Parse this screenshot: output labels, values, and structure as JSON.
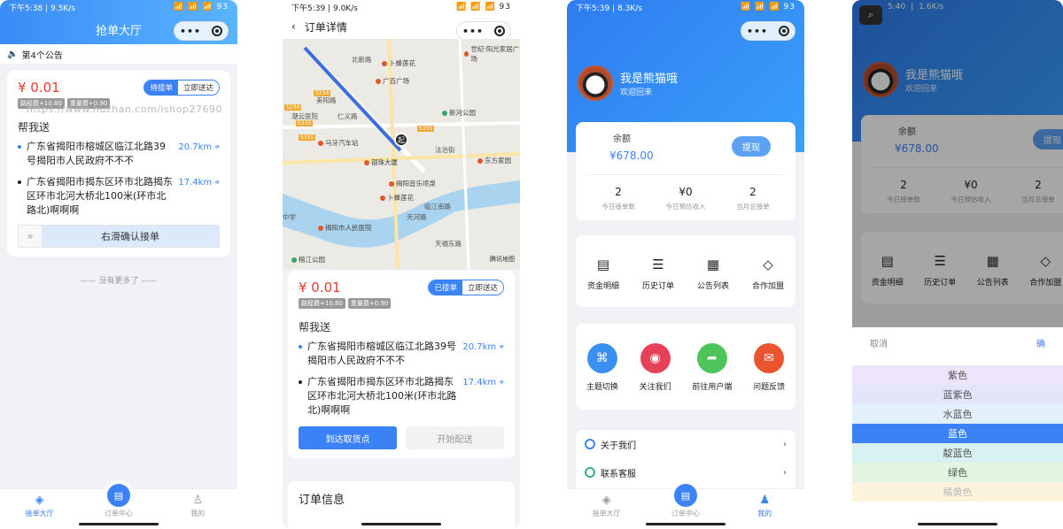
{
  "watermark": "https://www.huzhan.com/ishop27690",
  "screen1": {
    "status": {
      "time": "下午5:38",
      "speed": "9.5K/s",
      "icons": "📶 📶 📶 93"
    },
    "title": "抢单大厅",
    "notice": "第4个公告",
    "order": {
      "price": "¥ 0.01",
      "tag_active": "待接单",
      "tag_other": "立即送达",
      "fee1": "路程费+10.80",
      "fee2": "重量费+0.90",
      "help": "帮我送",
      "from": "广东省揭阳市榕城区临江北路39号揭阳市人民政府不不不",
      "from_dist": "20.7km",
      "to": "广东省揭阳市揭东区环市北路揭东区环市北河大桥北100米(环市北路北)啊啊啊",
      "to_dist": "17.4km",
      "slide_label": "右滑确认接单"
    },
    "nomore": "—— 没有更多了 ——",
    "tabs": [
      "接单大厅",
      "订单中心",
      "我的"
    ]
  },
  "screen2": {
    "status": {
      "time": "下午5:39",
      "speed": "9.0K/s",
      "icons": "📶 📶 📶 93"
    },
    "title": "订单详情",
    "map_labels": {
      "poi": [
        "卜蜂莲花",
        "广百广场",
        "新河公园",
        "马牙汽车站",
        "银珠大厦",
        "揭阳音乐喷泉",
        "卜蜂莲花",
        "揭阳市人民医院",
        "东方家园",
        "世纪·阳光家居广场",
        "榕江公园"
      ],
      "areas": [
        "北新路",
        "美阳路",
        "仁义路",
        "潮云医院",
        "法治街",
        "临江南路",
        "天福东路",
        "中学",
        "天河路"
      ],
      "shields": [
        "S234",
        "S234",
        "S335",
        "S335",
        "S335"
      ],
      "start_marker": "起",
      "logo": "腾讯地图"
    },
    "order": {
      "price": "¥ 0.01",
      "tag_active": "已接单",
      "tag_other": "立即送达",
      "fee1": "路程费+10.80",
      "fee2": "重量费+0.90",
      "help": "帮我送",
      "from": "广东省揭阳市榕城区临江北路39号揭阳市人民政府不不不",
      "from_dist": "20.7km",
      "to": "广东省揭阳市揭东区环市北路揭东区环市北河大桥北100米(环市北路北)啊啊啊",
      "to_dist": "17.4km",
      "btn_primary": "到达取货点",
      "btn_secondary": "开始配送"
    },
    "info_title": "订单信息"
  },
  "screen3": {
    "status": {
      "time": "下午5:39",
      "speed": "8.3K/s",
      "icons": "📶 📶 📶 93"
    },
    "name": "我是熊猫哦",
    "welcome": "欢迎回来",
    "balance_label": "余额",
    "balance": "¥678.00",
    "withdraw": "提现",
    "stats": [
      {
        "value": "2",
        "label": "今日接单数"
      },
      {
        "value": "¥0",
        "label": "今日预估收入"
      },
      {
        "value": "2",
        "label": "当月总接单"
      }
    ],
    "menu": [
      "资金明细",
      "历史订单",
      "公告列表",
      "合作加盟"
    ],
    "actions": [
      "主题切换",
      "关注我们",
      "前往用户端",
      "问题反馈"
    ],
    "action_colors": [
      "#3b8ff0",
      "#e6415a",
      "#4cc45a",
      "#ea5530"
    ],
    "list": [
      "关于我们",
      "联系客服"
    ],
    "tabs": [
      "接单大厅",
      "订单中心",
      "我的"
    ]
  },
  "screen4": {
    "status": {
      "time": "5:40",
      "speed": "1.6K/s"
    },
    "name": "我是熊猫哦",
    "welcome": "欢迎回来",
    "balance_label": "余额",
    "balance": "¥678.00",
    "withdraw": "提现",
    "stats": [
      {
        "value": "2",
        "label": "今日接单数"
      },
      {
        "value": "¥0",
        "label": "今日预估收入"
      },
      {
        "value": "2",
        "label": "当月总接单"
      }
    ],
    "menu": [
      "资金明细",
      "历史订单",
      "公告列表",
      "合作加盟"
    ],
    "cancel": "取消",
    "confirm": "确",
    "options": [
      "紫色",
      "蓝紫色",
      "水蓝色",
      "蓝色",
      "靛蓝色",
      "绿色",
      "橘黄色"
    ],
    "selected": "蓝色"
  }
}
